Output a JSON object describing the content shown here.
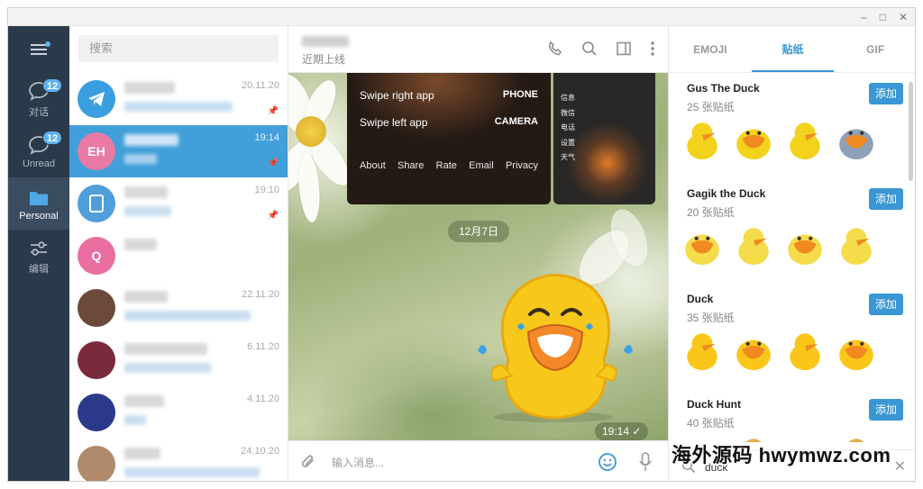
{
  "window": {
    "controls": [
      "–",
      "□",
      "✕"
    ]
  },
  "rail": {
    "items": [
      {
        "label": "对话",
        "badge": "12",
        "icon": "chat-bubble-icon"
      },
      {
        "label": "Unread",
        "badge": "12",
        "icon": "chat-bubble-icon"
      },
      {
        "label": "Personal",
        "icon": "folder-icon",
        "active": true
      },
      {
        "label": "编辑",
        "icon": "sliders-icon"
      }
    ]
  },
  "search": {
    "placeholder": "搜索"
  },
  "chats": [
    {
      "avatar_color": "#3a9fe0",
      "avatar_text": "",
      "time": "20.11.20",
      "pinned": true
    },
    {
      "avatar_color": "#e97aa5",
      "avatar_text": "EH",
      "time": "19:14",
      "pinned": true,
      "selected": true
    },
    {
      "avatar_color": "#4f9fdb",
      "avatar_text": "",
      "time": "19:10",
      "pinned": true
    },
    {
      "avatar_color": "#ea6ea0",
      "avatar_text": "Q",
      "time": ""
    },
    {
      "avatar_color": "#6b4a3a",
      "avatar_text": "",
      "time": "22.11.20"
    },
    {
      "avatar_color": "#7a2a3a",
      "avatar_text": "",
      "time": "6.11.20"
    },
    {
      "avatar_color": "#2a3a8a",
      "avatar_text": "",
      "time": "4.11.20"
    },
    {
      "avatar_color": "#b08a6a",
      "avatar_text": "",
      "time": "24.10.20"
    }
  ],
  "conversation": {
    "status": "近期上线",
    "date_separator": "12月7日",
    "sticker_time": "19:14",
    "composer_placeholder": "输入消息...",
    "image_left": {
      "rows": [
        {
          "left": "Swipe right app",
          "right": "PHONE"
        },
        {
          "left": "Swipe left app",
          "right": "CAMERA"
        }
      ],
      "footer": [
        "About",
        "Share",
        "Rate",
        "Email",
        "Privacy"
      ]
    },
    "image_right": {
      "labels": [
        "信息",
        "微信",
        "电话",
        "设置",
        "天气"
      ]
    }
  },
  "panel": {
    "tabs": [
      {
        "label": "EMOJI"
      },
      {
        "label": "贴纸",
        "active": true
      },
      {
        "label": "GIF"
      }
    ],
    "packs": [
      {
        "title": "Gus The Duck",
        "count": "25 张贴纸",
        "add": "添加"
      },
      {
        "title": "Gagik the Duck",
        "count": "20 张贴纸",
        "add": "添加"
      },
      {
        "title": "Duck",
        "count": "35 张贴纸",
        "add": "添加"
      },
      {
        "title": "Duck Hunt",
        "count": "40 张贴纸",
        "add": "添加"
      }
    ],
    "search_query": "duck"
  },
  "watermark": "海外源码 hwymwz.com",
  "colors": {
    "accent": "#3a96d4",
    "rail": "#2b3a4b",
    "selected": "#419fd9"
  }
}
